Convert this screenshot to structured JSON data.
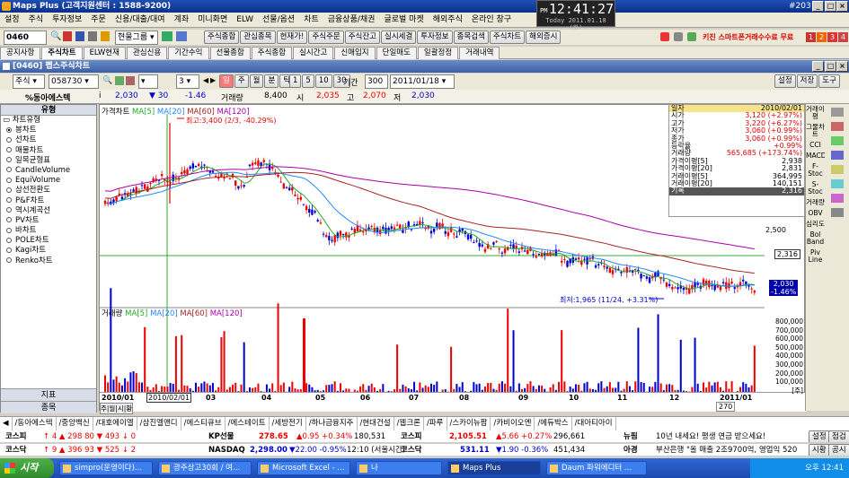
{
  "window": {
    "title": "Maps Plus (고객지원센터 : 1588-9200)",
    "screen_no": "#203"
  },
  "clock": {
    "ampm": "PM",
    "time": "12:41:27",
    "date": "Today 2011.01.18 (화)"
  },
  "menu": [
    "설정",
    "주식",
    "투자정보",
    "주문",
    "신용/대출/대여",
    "계좌",
    "미니화면",
    "ELW",
    "선물/옵션",
    "차트",
    "금융상품/채권",
    "글로벌 마켓",
    "해외주식",
    "온라인 창구"
  ],
  "toolbar1": {
    "code": "0460",
    "buttons": [
      "주식종합",
      "관심종목",
      "현재가!",
      "주식주문",
      "주식잔고",
      "실시세결",
      "투자정보",
      "종목검색",
      "주식차트",
      "해외증시"
    ],
    "ad": "키진 스마트폰거래수수료 무료",
    "pages": [
      "1",
      "2",
      "3",
      "4"
    ]
  },
  "tabs": [
    "공지사항",
    "주식차트",
    "ELW현재",
    "관심신용",
    "기간수익",
    "선물종합",
    "주식종합",
    "실시간고",
    "신매입지",
    "단일매도",
    "일괄정정",
    "거래내역"
  ],
  "chartwin": {
    "title": "[0460] 펩스주식차트"
  },
  "toolrow": {
    "market": "주식",
    "code": "058730",
    "periods": [
      "일",
      "주",
      "월",
      "분",
      "틱"
    ],
    "minutes": [
      "1",
      "5",
      "10",
      "30"
    ],
    "period_label": "기간",
    "period_value": "300",
    "date": "2011/01/18",
    "buttons": [
      "설정",
      "저장",
      "도구"
    ]
  },
  "info": {
    "name": "%동아에스텍",
    "price": "2,030",
    "change": "▼ 30",
    "pct": "-1.46",
    "vol_label": "거래량",
    "volume": "8,400",
    "open_label": "시",
    "open": "2,035",
    "high_label": "고",
    "high": "2,070",
    "low_label": "저",
    "low": "2,030"
  },
  "leftpanel": {
    "header": "유형",
    "group": "차트유형",
    "items": [
      "봉차트",
      "선차트",
      "매물차트",
      "일목균형표",
      "CandleVolume",
      "EquiVolume",
      "삼선전환도",
      "P&F차트",
      "역시계곡선",
      "PV차트",
      "바차트",
      "POLE차트",
      "Kagi차트",
      "Renko차트"
    ],
    "selected": 0,
    "footer1": "지표",
    "footer2": "종목"
  },
  "price_legend": {
    "label": "가격차트",
    "ma": [
      "MA[5]",
      "MA[20]",
      "MA[60]",
      "MA[120]"
    ]
  },
  "vol_legend": {
    "label": "거래량",
    "ma": [
      "MA[5]",
      "MA[20]",
      "MA[60]",
      "MA[120]"
    ]
  },
  "annotations": {
    "high": "최고:3,400 (2/3, -40.29%)",
    "low": "최저:1,965 (11/24, +3.31%)"
  },
  "price_axis": {
    "label1": "2,500",
    "current": "2,316",
    "last": "2,030",
    "last_pct": "-1.46%"
  },
  "vol_axis": [
    "800,000",
    "700,000",
    "600,000",
    "500,000",
    "400,000",
    "300,000",
    "200,000",
    "100,000",
    "[주]"
  ],
  "x_axis": {
    "labels": [
      "2010/01",
      "03",
      "04",
      "05",
      "06",
      "07",
      "08",
      "09",
      "10",
      "11",
      "12",
      "2011/01"
    ],
    "cursor": "2010/02/01",
    "count": "270"
  },
  "datatbl": {
    "rows": [
      [
        "일자",
        "2010/02/01"
      ],
      [
        "시가",
        "3,120 (+2.97%)"
      ],
      [
        "고가",
        "3,220 (+6.27%)"
      ],
      [
        "저가",
        "3,060 (+0.99%)"
      ],
      [
        "종가",
        "3,060 (+0.99%)"
      ],
      [
        "등락율",
        "+0.99%"
      ],
      [
        "거래량",
        "565,685 (+173.74%)"
      ],
      [
        "가격이평[5]",
        "2,938"
      ],
      [
        "가격이평[20]",
        "2,831"
      ],
      [
        "거래이평[5]",
        "364,995"
      ],
      [
        "거래이평[20]",
        "140,151"
      ],
      [
        "기록",
        "2,316"
      ]
    ]
  },
  "right_indicators": [
    "거래이평",
    "그물차트",
    "CCI",
    "MACD",
    "F-Stoc",
    "S-Stoc",
    "거래량",
    "OBV",
    "심리도",
    "Bol Band",
    "Piv Line"
  ],
  "stockbar": [
    "동아에스텍",
    "중앙백신",
    "대호에이엘",
    "삼진엘앤디",
    "에스티큐브",
    "에스테이트",
    "세방전기",
    "하나금융지주",
    "현대건설",
    "웹크론",
    "파루",
    "스카이뉴팜",
    "카비이오엔",
    "에듀박스",
    "대아티아이"
  ],
  "ticker1": {
    "a": "코스피",
    "a_nums": "↑ 4  ▲ 298  80  ▼ 493  ↓ 0",
    "b": "KP선물",
    "b_val": "278.65",
    "b_chg": "▲0.95 +0.34%",
    "b_vol": "180,531",
    "c": "코스피",
    "c_val": "2,105.51",
    "c_chg": "▲5.66 +0.27%",
    "c_vol": "296,661",
    "d": "뉴핌",
    "d_text": "10년 내세요! 평생 연금 받으세요!",
    "btn1": "설정",
    "btn2": "점검"
  },
  "ticker2": {
    "a": "코스닥",
    "a_nums": "↑ 9  ▲ 396  93  ▼ 525  ↓ 2",
    "b": "NASDAQ",
    "b_val": "2,298.00",
    "b_chg": "▼22.00 -0.95%",
    "b_time": "12:10 (서울시간)",
    "c": "코스닥",
    "c_val": "531.11",
    "c_chg": "▼1.90 -0.36%",
    "c_vol": "451,434",
    "d": "아경",
    "d_text": "부산은행 \"올 매출 2조9700억, 영업익 520",
    "btn1": "시황",
    "btn2": "공시"
  },
  "taskbar": {
    "start": "시작",
    "tasks": [
      "simpro(운영이다)...",
      "광주상고30회 / 여...",
      "Microsoft Excel - ...",
      "나",
      "Maps Plus",
      "Daum 파워에디터 ..."
    ],
    "active": 4,
    "time": "오후 12:41"
  }
}
